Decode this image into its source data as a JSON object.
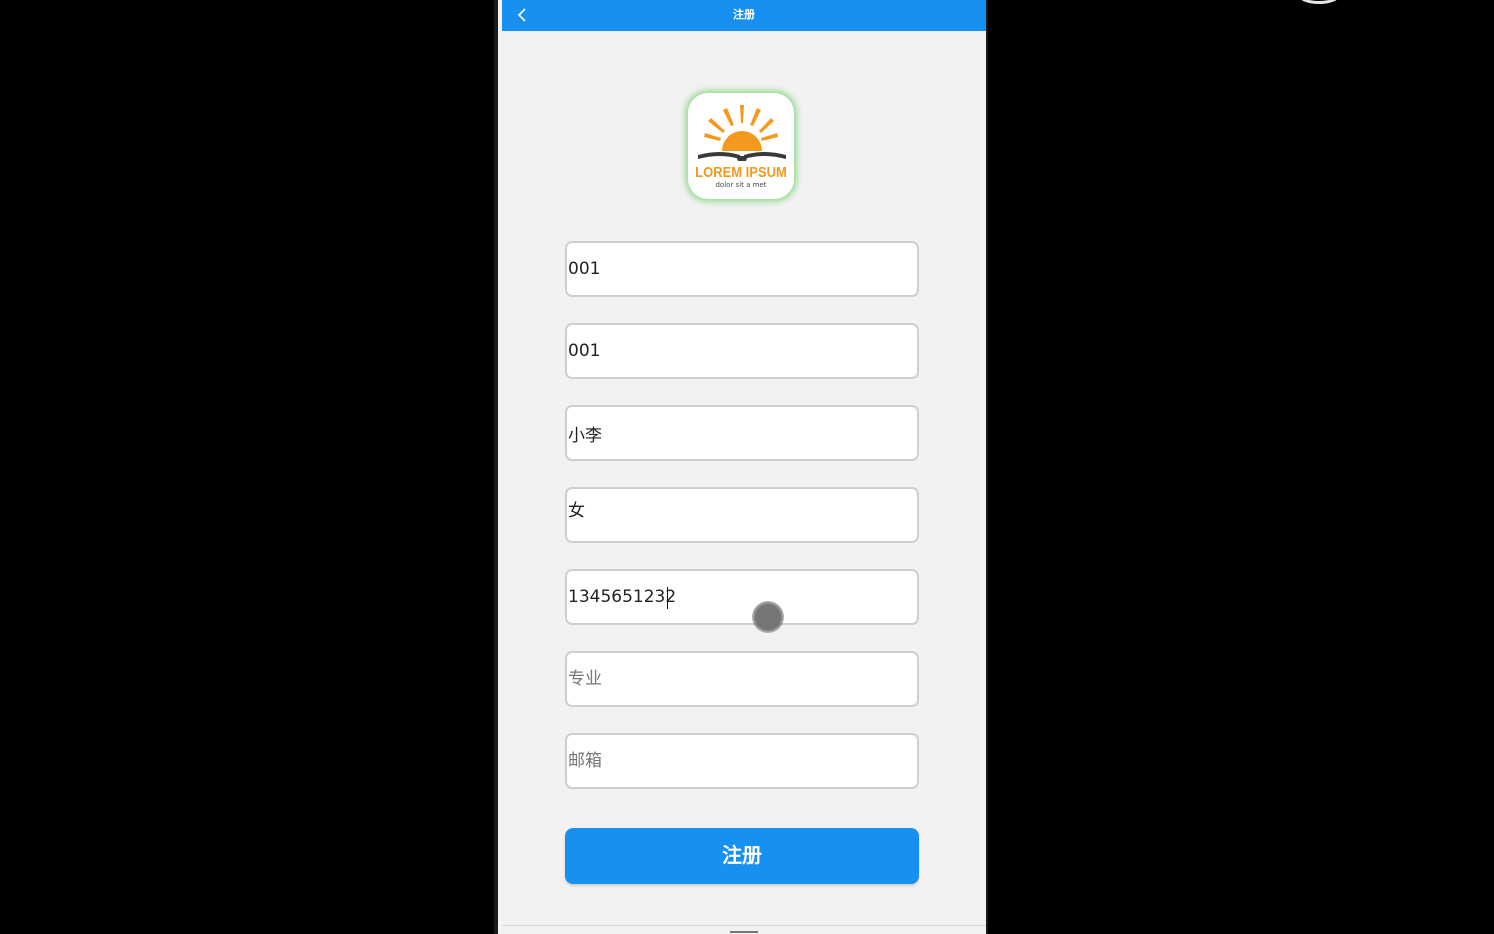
{
  "appbar": {
    "title": "注册",
    "back_icon": "chevron-left-icon"
  },
  "logo": {
    "title": "LOREM IPSUM",
    "subtitle": "dolor sit a met"
  },
  "form": {
    "fields": [
      {
        "value": "001",
        "placeholder": ""
      },
      {
        "value": "001",
        "placeholder": ""
      },
      {
        "value": "小李",
        "placeholder": ""
      },
      {
        "value": "女",
        "placeholder": ""
      },
      {
        "value": "1345651232",
        "placeholder": ""
      },
      {
        "value": "",
        "placeholder": "专业"
      },
      {
        "value": "",
        "placeholder": "邮箱"
      }
    ],
    "submit_label": "注册"
  },
  "colors": {
    "accent": "#1890f0",
    "background": "#f2f2f2",
    "logo_sun": "#f39a1e",
    "logo_book": "#3a3a3a"
  }
}
